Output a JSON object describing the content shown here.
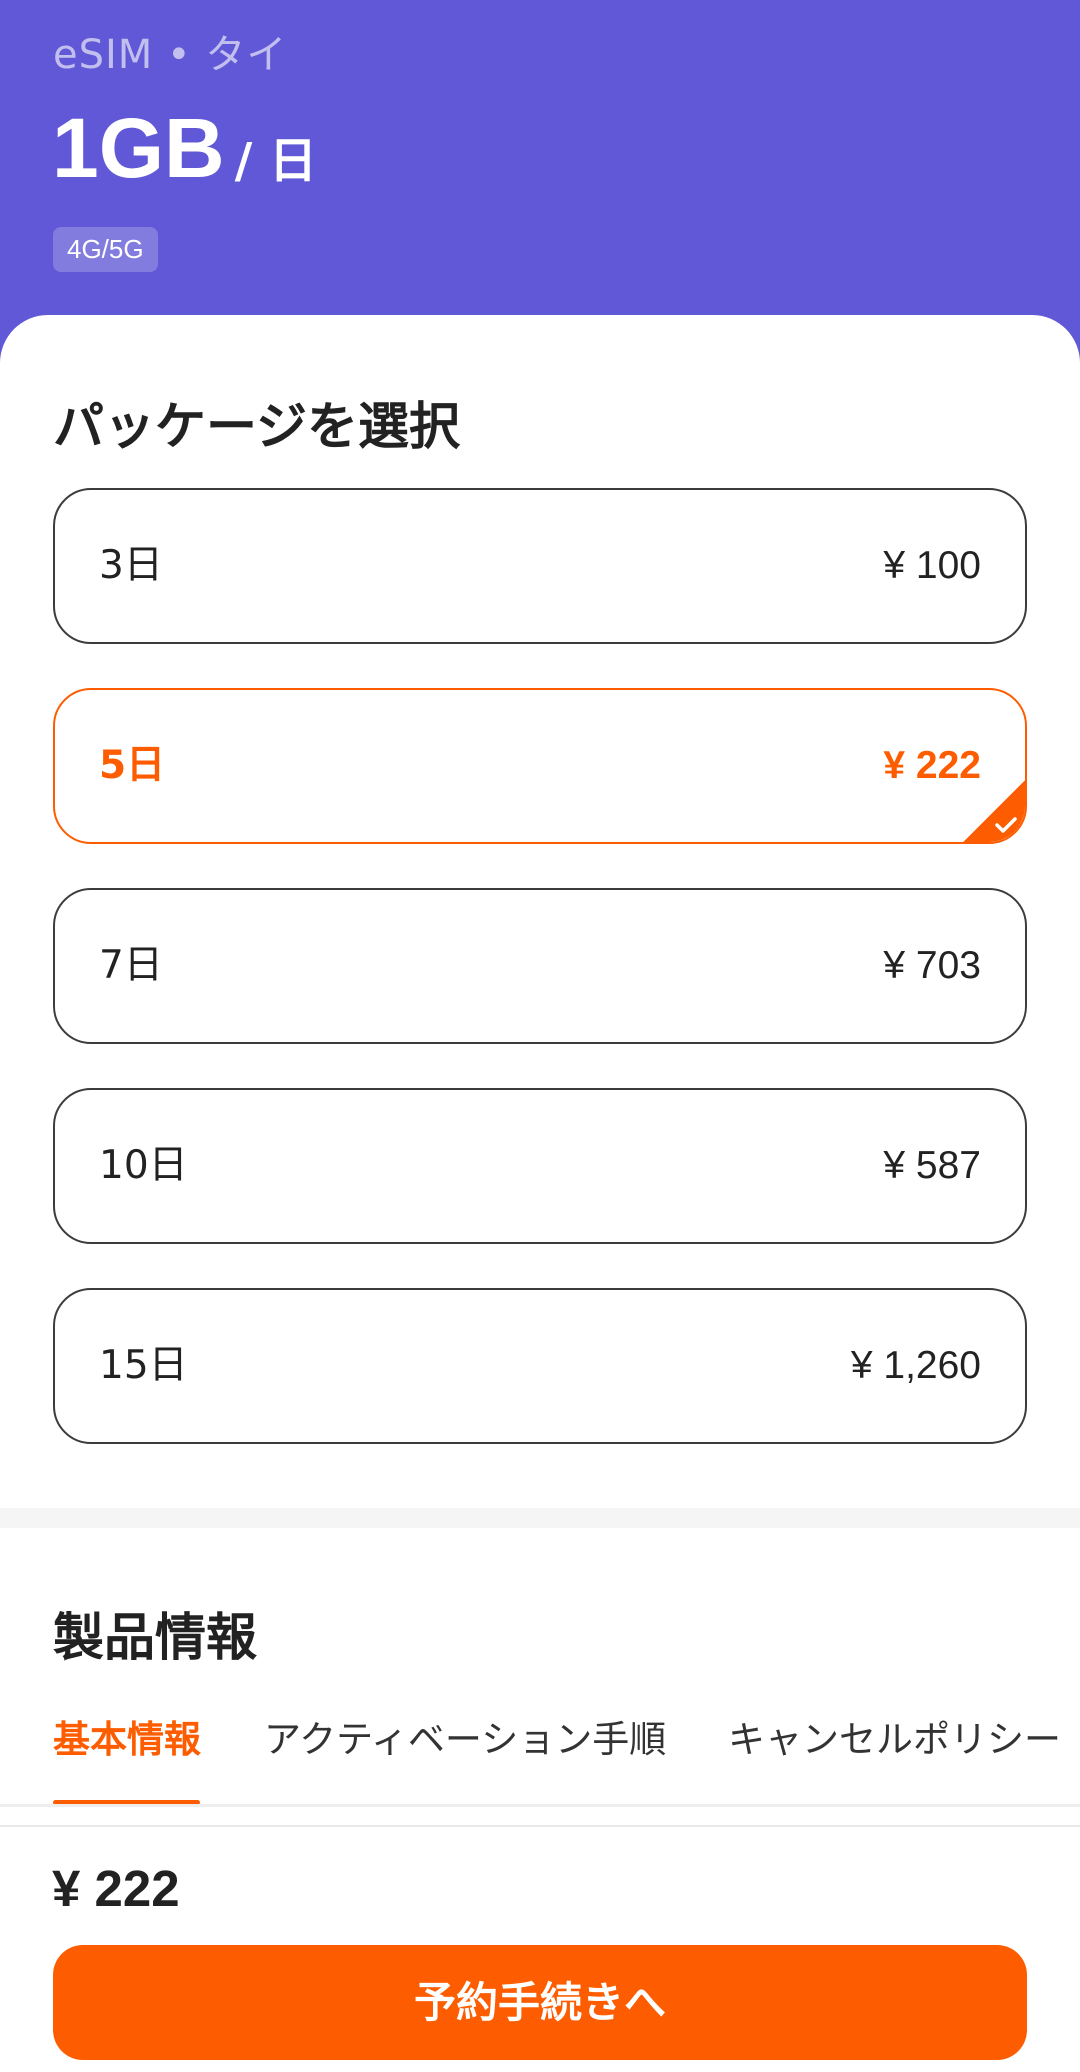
{
  "header": {
    "subtitle": "eSIM • タイ",
    "data_amount": "1GB",
    "per_unit": "/ 日",
    "network_badge": "4G/5G"
  },
  "package_section": {
    "title": "パッケージを選択",
    "packages": [
      {
        "days": "3日",
        "price": "¥ 100",
        "selected": false
      },
      {
        "days": "5日",
        "price": "¥ 222",
        "selected": true
      },
      {
        "days": "7日",
        "price": "¥ 703",
        "selected": false
      },
      {
        "days": "10日",
        "price": "¥ 587",
        "selected": false
      },
      {
        "days": "15日",
        "price": "¥ 1,260",
        "selected": false
      }
    ]
  },
  "product_info": {
    "title": "製品情報",
    "tabs": [
      {
        "label": "基本情報",
        "active": true
      },
      {
        "label": "アクティベーション手順",
        "active": false
      },
      {
        "label": "キャンセルポリシー",
        "active": false
      }
    ]
  },
  "footer": {
    "total_price": "¥ 222",
    "cta_label": "予約手続きへ"
  },
  "colors": {
    "header_bg": "#6058d6",
    "accent": "#fd5d00"
  }
}
